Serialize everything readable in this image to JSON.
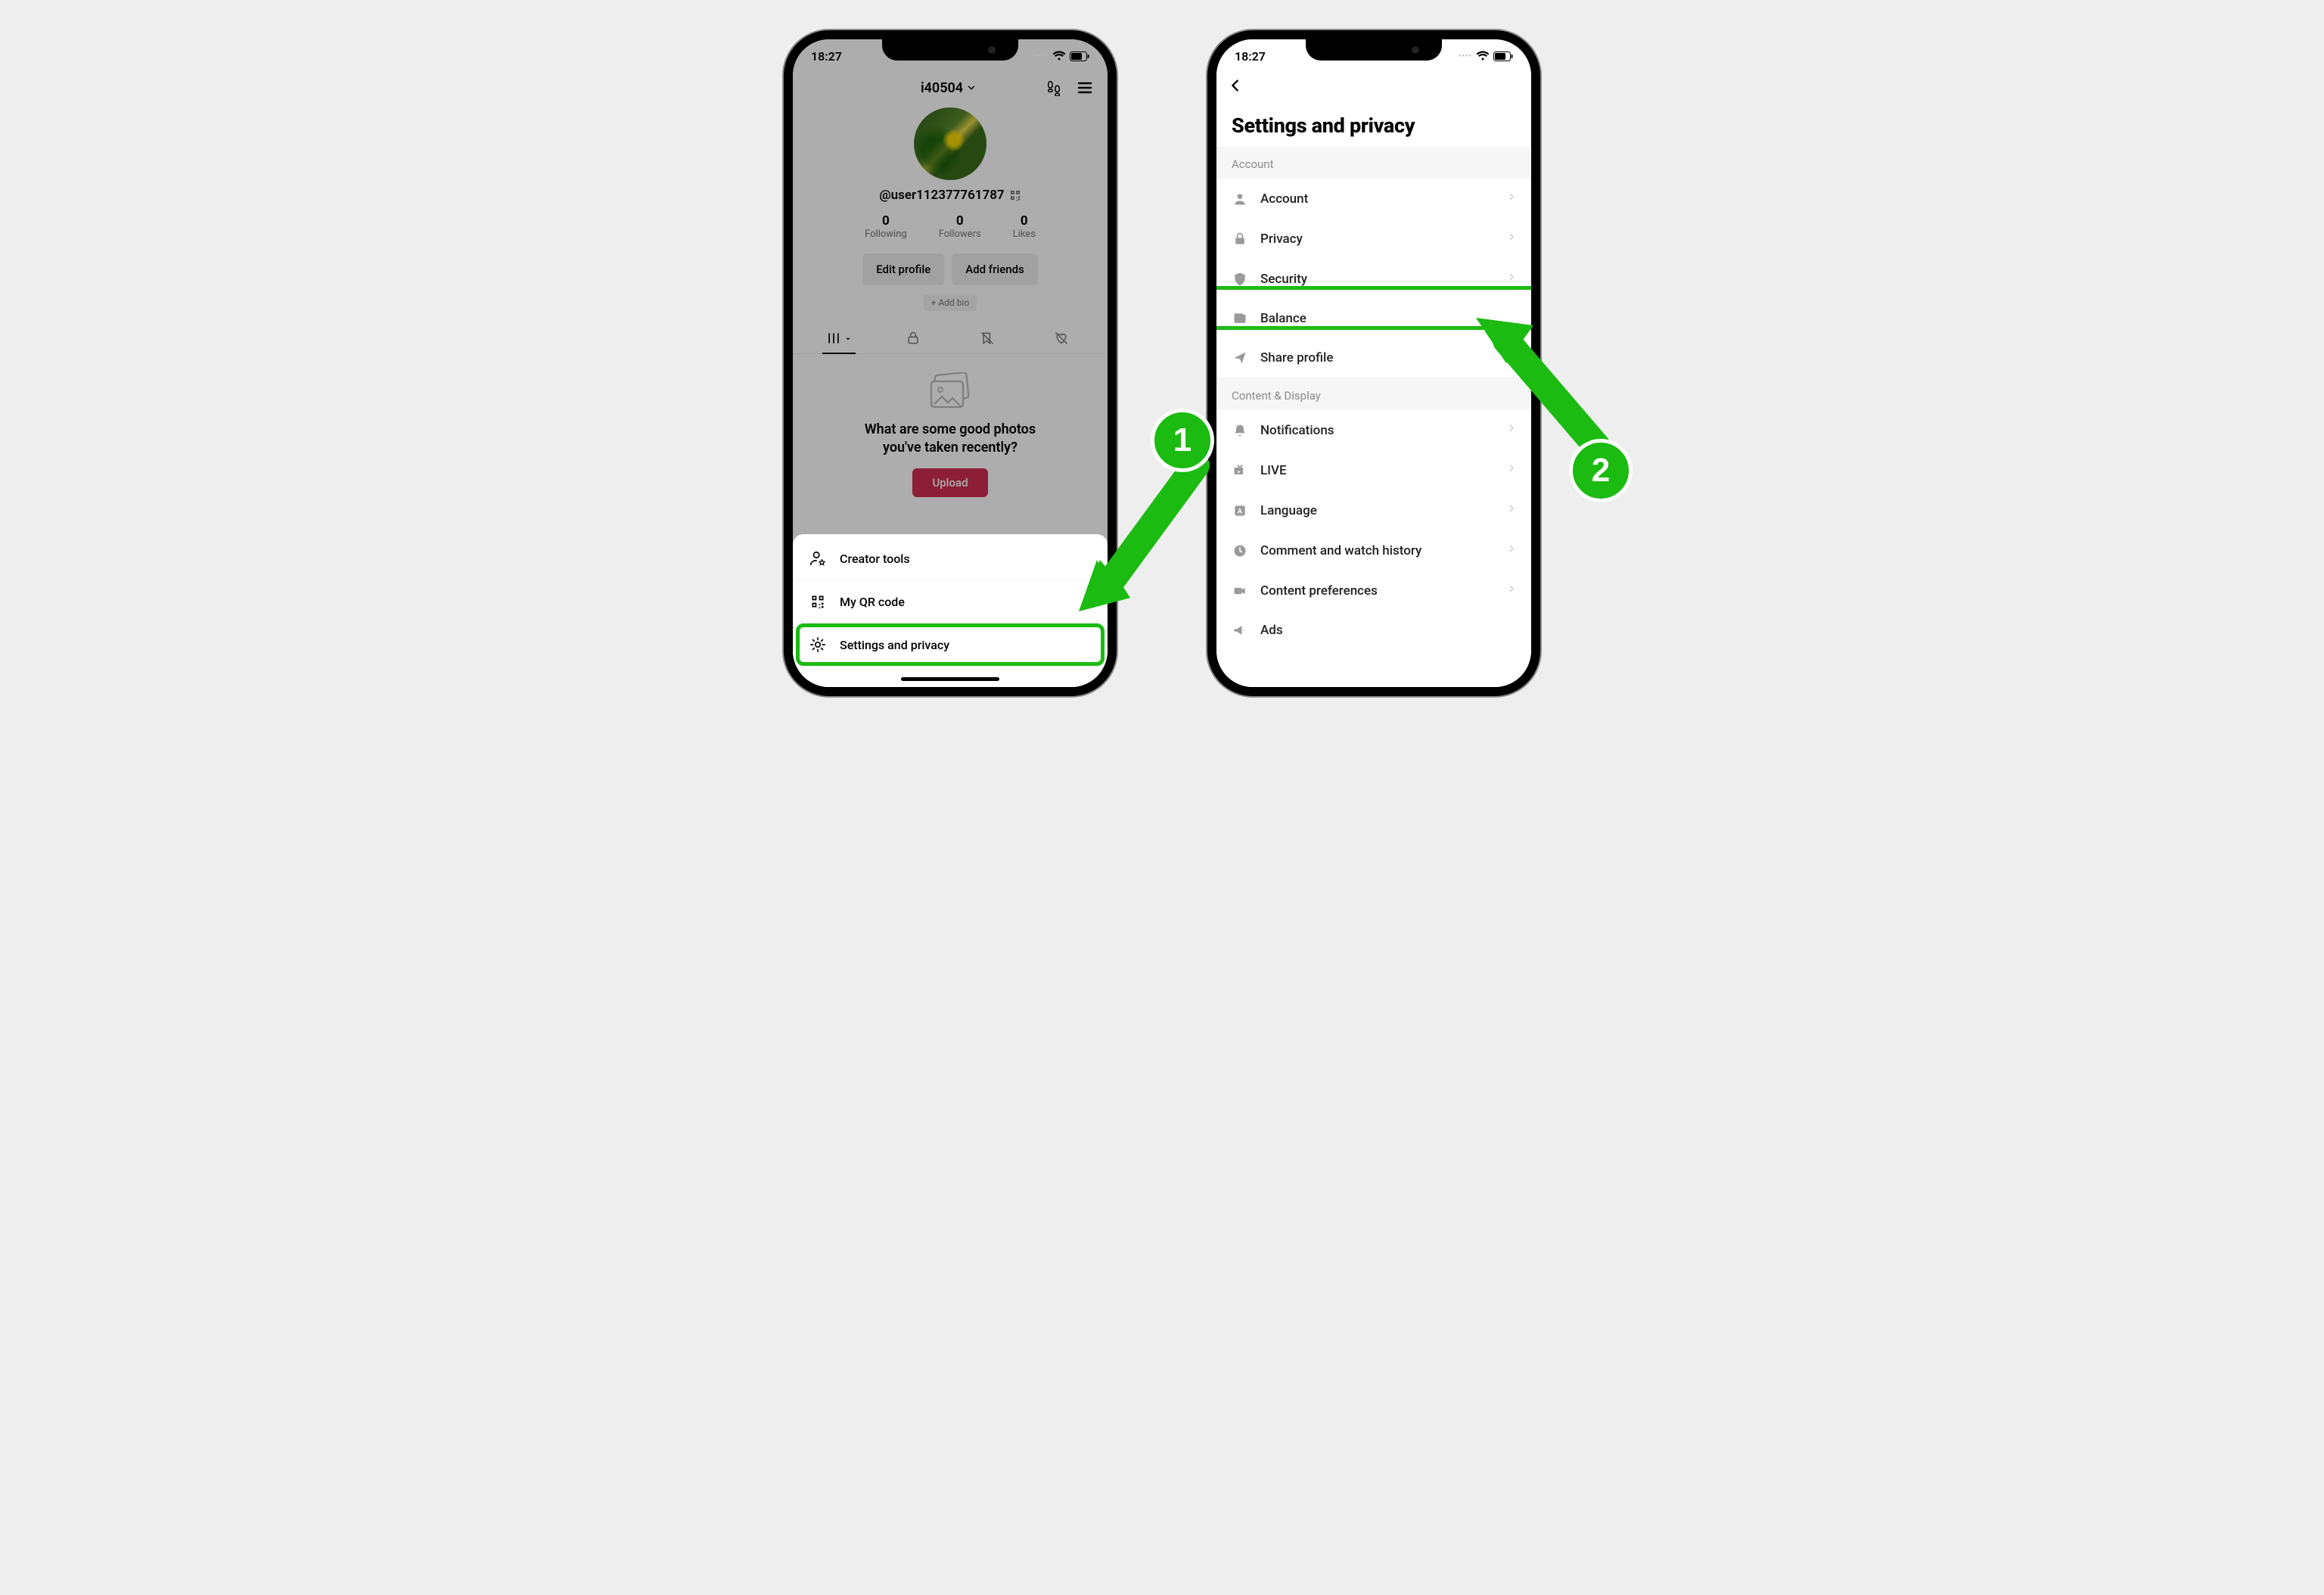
{
  "statusbar": {
    "time": "18:27"
  },
  "phone1": {
    "header": {
      "name": "i40504"
    },
    "username": "@user112377761787",
    "stats": {
      "following_count": "0",
      "following_label": "Following",
      "followers_count": "0",
      "followers_label": "Followers",
      "likes_count": "0",
      "likes_label": "Likes"
    },
    "buttons": {
      "edit_profile": "Edit profile",
      "add_friends": "Add friends",
      "add_bio": "+ Add bio"
    },
    "empty_state": {
      "line1": "What are some good photos",
      "line2": "you've taken recently?",
      "upload": "Upload"
    },
    "sheet": {
      "creator_tools": "Creator tools",
      "qr_code": "My QR code",
      "settings_privacy": "Settings and privacy"
    },
    "step_badge": "1"
  },
  "phone2": {
    "title": "Settings and privacy",
    "sections": {
      "account_header": "Account",
      "content_header": "Content & Display"
    },
    "rows": {
      "account": "Account",
      "privacy": "Privacy",
      "security": "Security",
      "balance": "Balance",
      "share_profile": "Share profile",
      "notifications": "Notifications",
      "live": "LIVE",
      "language": "Language",
      "comment_history": "Comment and watch history",
      "content_prefs": "Content preferences",
      "ads": "Ads"
    },
    "step_badge": "2"
  }
}
